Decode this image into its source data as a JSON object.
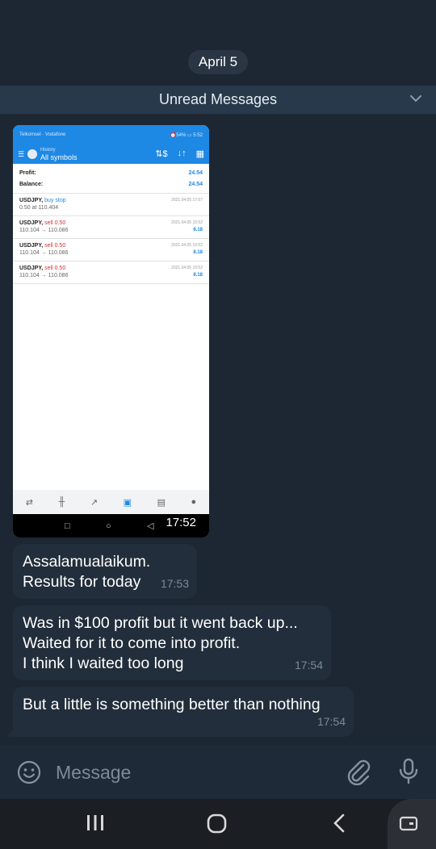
{
  "date_pill": "April 5",
  "unread_label": "Unread Messages",
  "photo": {
    "status_left": "Telkomsel · Vodafone",
    "status_right": "⏰54% ▭ 5:52",
    "header_sub": "History",
    "header_title": "All symbols",
    "profit_label": "Profit:",
    "profit_value": "24.54",
    "balance_label": "Balance:",
    "balance_value": "24.54",
    "trades": [
      {
        "symbol": "USDJPY,",
        "action": "buy stop",
        "action_type": "buy",
        "sub": "0.50 at 110.404",
        "date": "2021.04.05 17:07",
        "pl": ""
      },
      {
        "symbol": "USDJPY,",
        "action": "sell 0.50",
        "action_type": "sell",
        "sub": "110.104 → 110.086",
        "date": "2021.04.05 10:52",
        "pl": "8.18"
      },
      {
        "symbol": "USDJPY,",
        "action": "sell 0.50",
        "action_type": "sell",
        "sub": "110.104 → 110.086",
        "date": "2021.04.05 10:52",
        "pl": "8.18"
      },
      {
        "symbol": "USDJPY,",
        "action": "sell 0.50",
        "action_type": "sell",
        "sub": "110.104 → 110.086",
        "date": "2021.04.05 10:52",
        "pl": "8.18"
      }
    ],
    "time": "17:52"
  },
  "messages": [
    {
      "text_line1": "Assalamualaikum.",
      "text_line2": "Results for today",
      "time": "17:53"
    },
    {
      "text_line1": "Was in $100 profit but it went back up...",
      "text_line2": "Waited for it to come into profit.",
      "text_line3": "I think I waited too long",
      "time": "17:54"
    },
    {
      "text_line1": "But a little is something better than nothing",
      "time": "17:54"
    }
  ],
  "composer": {
    "placeholder": "Message"
  },
  "colors": {
    "background": "#1d2733",
    "bubble": "#222e3b",
    "accent": "#1e88e5"
  }
}
